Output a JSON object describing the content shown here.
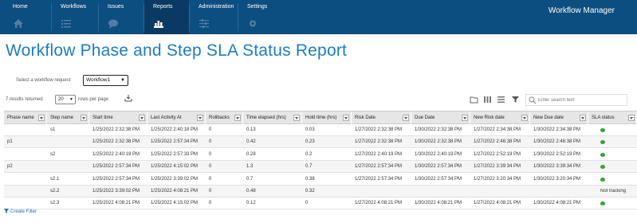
{
  "nav": {
    "items": [
      {
        "label": "Home",
        "icon": "home-icon"
      },
      {
        "label": "Workflows",
        "icon": "list-icon"
      },
      {
        "label": "Issues",
        "icon": "chat-bubble-icon"
      },
      {
        "label": "Reports",
        "icon": "bar-chart-icon"
      },
      {
        "label": "Administration",
        "icon": "sliders-icon"
      },
      {
        "label": "Settings",
        "icon": "gear-icon"
      }
    ],
    "active": "Reports",
    "app_title": "Workflow Manager"
  },
  "page": {
    "title": "Workflow Phase and Step SLA Status Report"
  },
  "workflow_select": {
    "label": "Select a workflow request",
    "value": "Workflow1"
  },
  "results": {
    "summary": "7 results returned",
    "page_size": "20",
    "rows_per_page_label": "rows per page",
    "search_placeholder": "Enter search text"
  },
  "table": {
    "columns": [
      "Phase name",
      "Step name",
      "Start time",
      "Last Activity At",
      "Rollbacks",
      "Time elapsed (hrs)",
      "Hold time (hrs)",
      "Risk Date",
      "Due Date",
      "New Risk date",
      "New Due date",
      "SLA status"
    ],
    "rows": [
      [
        "",
        "s1",
        "1/25/2022 2:32:38 PM",
        "1/25/2022 2:40:18 PM",
        "0",
        "0.13",
        "0.03",
        "1/27/2022 2:32:38 PM",
        "1/30/2022 2:32:38 PM",
        "1/27/2022 2:34:38 PM",
        "1/30/2022 2:34:38 PM",
        "dot"
      ],
      [
        "p1",
        "",
        "1/25/2022 2:32:38 PM",
        "1/25/2022 2:57:34 PM",
        "0",
        "0.42",
        "0.23",
        "1/27/2022 2:32:38 PM",
        "1/30/2022 2:32:38 PM",
        "1/27/2022 2:46:38 PM",
        "1/30/2022 2:46:38 PM",
        "dot"
      ],
      [
        "",
        "s2",
        "1/25/2022 2:40:19 PM",
        "1/25/2022 2:57:33 PM",
        "0",
        "0.28",
        "0.2",
        "1/27/2022 2:40:19 PM",
        "1/30/2022 2:40:19 PM",
        "1/27/2022 2:52:19 PM",
        "1/30/2022 2:52:19 PM",
        "dot"
      ],
      [
        "p2",
        "",
        "1/25/2022 2:57:34 PM",
        "1/25/2022 4:15:02 PM",
        "0",
        "1.3",
        "0.7",
        "1/27/2022 2:57:34 PM",
        "1/30/2022 2:57:34 PM",
        "1/27/2022 3:39:34 PM",
        "1/30/2022 3:39:34 PM",
        "dot"
      ],
      [
        "",
        "s2.1",
        "1/25/2022 2:57:34 PM",
        "1/25/2022 3:39:02 PM",
        "0",
        "0.7",
        "0.38",
        "1/27/2022 2:57:34 PM",
        "1/30/2022 2:57:34 PM",
        "1/27/2022 3:20:34 PM",
        "1/30/2022 3:20:34 PM",
        "dot"
      ],
      [
        "",
        "s2.2",
        "1/25/2022 3:39:02 PM",
        "1/25/2022 4:08:21 PM",
        "0",
        "0.48",
        "0.32",
        "",
        "",
        "",
        "",
        "Not tracking"
      ],
      [
        "",
        "s2.3",
        "1/25/2022 4:08:21 PM",
        "1/25/2022 4:15:02 PM",
        "0",
        "0.12",
        "0",
        "1/27/2022 4:08:21 PM",
        "1/30/2022 4:08:21 PM",
        "1/27/2022 4:08:21 PM",
        "1/30/2022 4:08:21 PM",
        "dot"
      ]
    ]
  },
  "footer": {
    "create_filter": "Create Filter"
  },
  "colors": {
    "nav_bg": "#0d4e80",
    "title": "#1c7dbf",
    "sla_ok": "#3aa035"
  }
}
